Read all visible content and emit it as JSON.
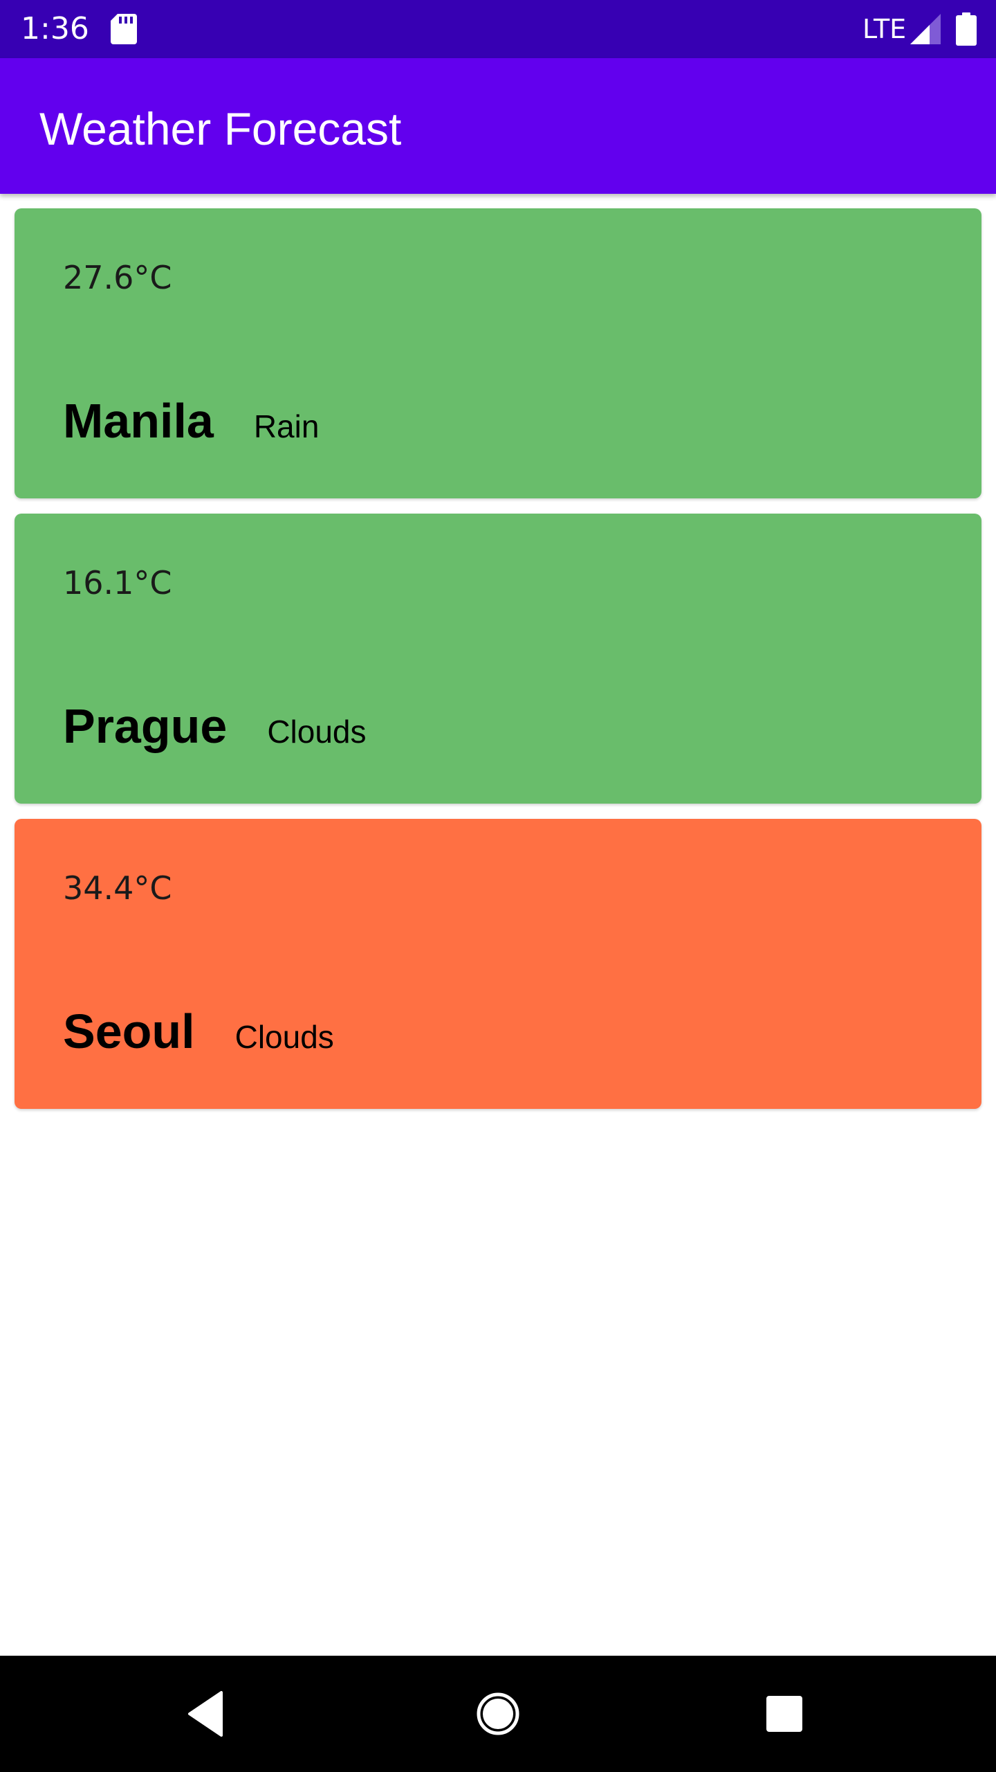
{
  "status_bar": {
    "time": "1:36",
    "network": "LTE",
    "icons": [
      "sd-card-icon",
      "signal-icon",
      "battery-icon"
    ]
  },
  "app_bar": {
    "title": "Weather Forecast",
    "color": "#6200ee"
  },
  "forecasts": [
    {
      "temperature": "27.6°C",
      "city": "Manila",
      "condition": "Rain",
      "color": "#69bd6b"
    },
    {
      "temperature": "16.1°C",
      "city": "Prague",
      "condition": "Clouds",
      "color": "#69bd6b"
    },
    {
      "temperature": "34.4°C",
      "city": "Seoul",
      "condition": "Clouds",
      "color": "#ff7043"
    }
  ],
  "nav_bar": {
    "buttons": [
      "back-icon",
      "home-icon",
      "recents-icon"
    ]
  }
}
